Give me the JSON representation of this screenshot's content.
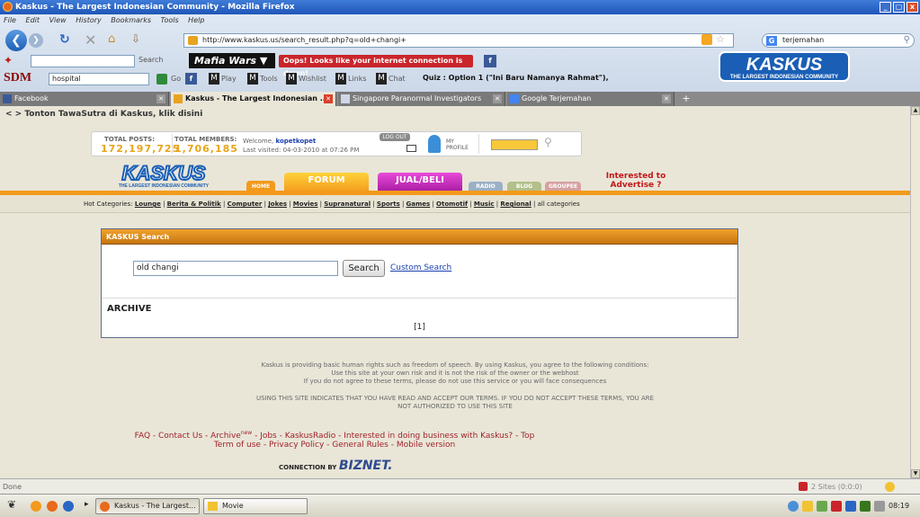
{
  "window": {
    "title": "Kaskus - The Largest Indonesian Community - Mozilla Firefox",
    "min": "_",
    "max": "▢",
    "close": "x"
  },
  "menu": [
    "File",
    "Edit",
    "View",
    "History",
    "Bookmarks",
    "Tools",
    "Help"
  ],
  "nav": {
    "url": "http://www.kaskus.us/search_result.php?q=old+changi+",
    "search_value": "terjemahan"
  },
  "toolbar1": {
    "search_label": "Search",
    "mafia": "Mafia Wars ▼",
    "alert": "Oops! Looks like your internet connection is down!"
  },
  "toolbar2": {
    "sdm": "SDM",
    "field": "hospital",
    "go": "Go",
    "items": [
      "Play",
      "Tools",
      "Wishlist",
      "Links",
      "Chat"
    ],
    "quiz": "Quiz : Option 1 (\"Ini Baru Namanya Rahmat\"),"
  },
  "tabs": [
    {
      "label": "Facebook",
      "active": false
    },
    {
      "label": "Kaskus - The Largest Indonesian ...",
      "active": true
    },
    {
      "label": "Singapore Paranormal Investigators",
      "active": false
    },
    {
      "label": "Google Terjemahan",
      "active": false
    }
  ],
  "page": {
    "tonton": "< > Tonton TawaSutra di Kaskus, klik disini",
    "stats": {
      "posts_label": "TOTAL POSTS:",
      "posts": "172,197,725",
      "members_label": "TOTAL MEMBERS:",
      "members": "1,706,185",
      "welcome": "Welcome,",
      "user": "kopetkopet",
      "visited": "Last visited: 04-03-2010 at 07:26 PM",
      "logout": "LOG OUT",
      "my": "MY",
      "profile": "PROFILE"
    },
    "logo_text": "KASKUS",
    "logo_tag": "THE LARGEST INDONESIAN COMMUNITY",
    "nav_tabs": [
      "HOME",
      "FORUM",
      "JUAL/BELI",
      "RADIO",
      "BLOG",
      "GROUPEE"
    ],
    "advertise": "Interested to Advertise ?",
    "hot_label": "Hot Categories:",
    "hot_cats": [
      "Lounge",
      "Berita & Politik",
      "Computer",
      "Jokes",
      "Movies",
      "Supranatural",
      "Sports",
      "Games",
      "Otomotif",
      "Music",
      "Regional"
    ],
    "all_cats": "all categories",
    "search_header": "KASKUS Search",
    "query": "old changi",
    "search_button": "Search",
    "custom_search": "Custom Search",
    "archive": "ARCHIVE",
    "page_nav": "[1]",
    "footer1": "Kaskus is providing basic human rights such as freedom of speech. By using Kaskus, you agree to the following conditions:",
    "footer2": "Use this site at your own risk and it is not the risk of the owner or the webhost",
    "footer3": "If you do not agree to these terms, please do not use this service or you will face consequences",
    "footer4": "USING THIS SITE INDICATES THAT YOU HAVE READ AND ACCEPT OUR TERMS. IF YOU DO NOT ACCEPT THESE TERMS, YOU ARE",
    "footer5": "NOT AUTHORIZED TO USE THIS SITE",
    "links1": "FAQ - Contact Us - Archive",
    "links1_sup": "new",
    "links1b": " - Jobs - KaskusRadio - Interested in doing business with Kaskus? - Top",
    "links2": "Term of use - Privacy Policy - General Rules - Mobile version",
    "conn_by": "CONNECTION BY",
    "biznet": "BIZNET."
  },
  "status": {
    "left": "Done",
    "right": "2 Sites (0:0:0)"
  },
  "taskbar": {
    "tasks": [
      "Kaskus - The Largest...",
      "Movie"
    ],
    "clock": "08:19"
  }
}
